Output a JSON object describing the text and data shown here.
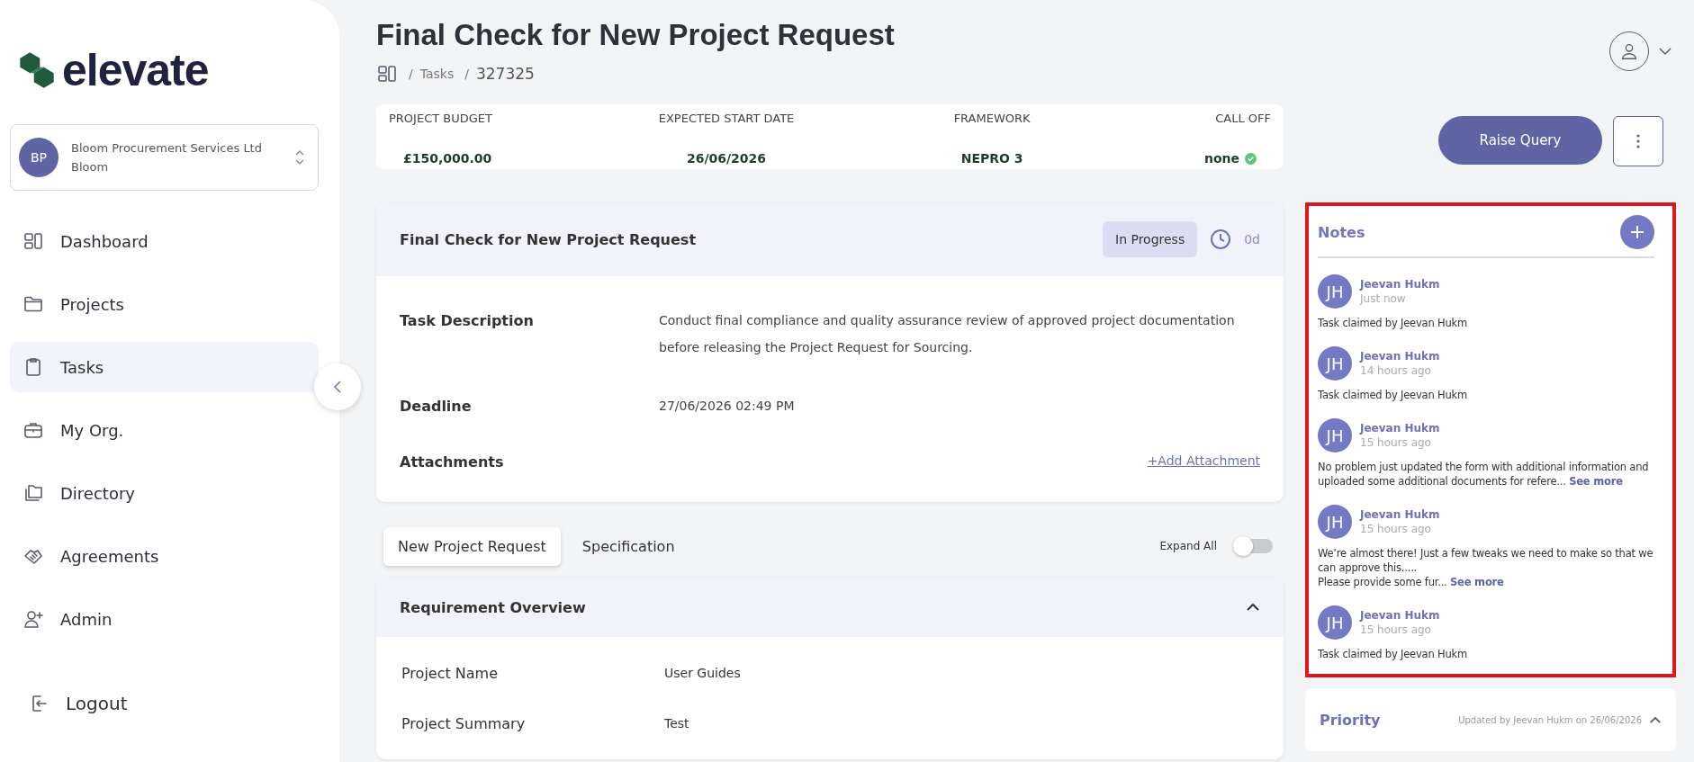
{
  "sidebar": {
    "logo": "elevate",
    "org": {
      "initials": "BP",
      "name": "Bloom Procurement Services Ltd",
      "short": "Bloom"
    },
    "items": [
      {
        "label": "Dashboard",
        "selected": false
      },
      {
        "label": "Projects",
        "selected": false
      },
      {
        "label": "Tasks",
        "selected": true
      },
      {
        "label": "My Org.",
        "selected": false
      },
      {
        "label": "Directory",
        "selected": false
      },
      {
        "label": "Agreements",
        "selected": false
      },
      {
        "label": "Admin",
        "selected": false
      }
    ],
    "logout": "Logout"
  },
  "page": {
    "title": "Final Check for New Project Request",
    "breadcrumb": [
      {
        "kind": "separator",
        "text": "/"
      },
      {
        "kind": "link",
        "text": "Tasks"
      },
      {
        "kind": "separator",
        "text": "/"
      },
      {
        "kind": "current",
        "text": "327325"
      }
    ]
  },
  "summary": [
    {
      "label": "PROJECT BUDGET",
      "value": "£150,000.00"
    },
    {
      "label": "EXPECTED START DATE",
      "value": "26/06/2026"
    },
    {
      "label": "FRAMEWORK",
      "value": "NEPRO 3"
    },
    {
      "label": "CALL OFF",
      "value": "none",
      "check": true
    }
  ],
  "task": {
    "title": "Final Check for New Project Request",
    "status": "In Progress",
    "age": "0d",
    "fields": [
      {
        "label": "Task Description",
        "value": "Conduct final compliance and quality assurance review of approved project documentation before releasing the Project Request for Sourcing."
      },
      {
        "label": "Deadline",
        "value": "27/06/2026 02:49 PM"
      },
      {
        "label": "Attachments",
        "link": "+Add Attachment"
      }
    ]
  },
  "tabs": [
    {
      "label": "New Project Request",
      "selected": true
    },
    {
      "label": "Specification",
      "selected": false
    }
  ],
  "expand_all": {
    "label": "Expand All",
    "on": false
  },
  "section": {
    "title": "Requirement Overview",
    "expanded": true,
    "rows": [
      {
        "label": "Project Name",
        "value": "User Guides"
      },
      {
        "label": "Project Summary",
        "value": "Test"
      }
    ]
  },
  "actions": {
    "primary": "Raise Query"
  },
  "notes": {
    "title": "Notes",
    "highlighted": true,
    "items": [
      {
        "initials": "JH",
        "author": "Jeevan Hukm",
        "time": "Just now",
        "text": "Task claimed by Jeevan Hukm"
      },
      {
        "initials": "JH",
        "author": "Jeevan Hukm",
        "time": "14 hours ago",
        "text": "Task claimed by Jeevan Hukm"
      },
      {
        "initials": "JH",
        "author": "Jeevan Hukm",
        "time": "15 hours ago",
        "text": "No problem just updated the form with additional information and uploaded some additional documents for refere...",
        "more": "See more"
      },
      {
        "initials": "JH",
        "author": "Jeevan Hukm",
        "time": "15 hours ago",
        "text": "We’re almost there! Just a few tweaks we need to make so that we can approve this.....\nPlease provide some fur...",
        "more": "See more"
      },
      {
        "initials": "JH",
        "author": "Jeevan Hukm",
        "time": "15 hours ago",
        "text": "Task claimed by Jeevan Hukm"
      }
    ]
  },
  "priority": {
    "title": "Priority",
    "updated": "Updated by Jeevan Hukm on 26/06/2026",
    "expanded": true
  }
}
